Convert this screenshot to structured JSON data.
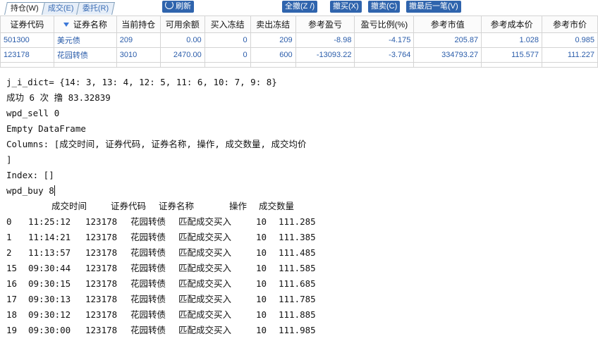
{
  "toolbar": {
    "tabs": [
      "持仓(W)",
      "成交(E)",
      "委托(R)"
    ],
    "refresh_label": "刷新",
    "cancel_all_label": "全撤(Z /)",
    "cancel_buy_label": "撤买(X)",
    "cancel_sell_label": "撤卖(C)",
    "cancel_last_label": "撤最后一笔(V)",
    "colors": {
      "button_bg": "#2f64ad",
      "cell_text": "#2a5caa"
    }
  },
  "positions": {
    "columns": [
      "证券代码",
      "证券名称",
      "当前持仓",
      "可用余额",
      "买入冻结",
      "卖出冻结",
      "参考盈亏",
      "盈亏比例(%)",
      "参考市值",
      "参考成本价",
      "参考市价"
    ],
    "rows": [
      [
        "501300",
        "美元债",
        "209",
        "0.00",
        "0",
        "209",
        "-8.98",
        "-4.175",
        "205.87",
        "1.028",
        "0.985"
      ],
      [
        "123178",
        "花园转债",
        "3010",
        "2470.00",
        "0",
        "600",
        "-13093.22",
        "-3.764",
        "334793.27",
        "115.577",
        "111.227"
      ]
    ]
  },
  "console": {
    "lines": [
      "j_i_dict= {14: 3, 13: 4, 12: 5, 11: 6, 10: 7, 9: 8}",
      "成功 6 次 撸 83.32839",
      "wpd_sell 0",
      "Empty DataFrame",
      "Columns: [成交时间, 证券代码, 证券名称, 操作, 成交数量, 成交均价",
      "]",
      "Index: []",
      "wpd_buy 8"
    ],
    "df_columns": [
      "成交时间",
      "证券代码",
      "证券名称",
      "操作",
      "成交数量"
    ],
    "df_rows": [
      [
        "0",
        "11:25:12",
        "123178",
        "花园转债",
        "匹配成交买入",
        "10",
        "111.285"
      ],
      [
        "1",
        "11:14:21",
        "123178",
        "花园转债",
        "匹配成交买入",
        "10",
        "111.385"
      ],
      [
        "2",
        "11:13:57",
        "123178",
        "花园转债",
        "匹配成交买入",
        "10",
        "111.485"
      ],
      [
        "15",
        "09:30:44",
        "123178",
        "花园转债",
        "匹配成交买入",
        "10",
        "111.585"
      ],
      [
        "16",
        "09:30:15",
        "123178",
        "花园转债",
        "匹配成交买入",
        "10",
        "111.685"
      ],
      [
        "17",
        "09:30:13",
        "123178",
        "花园转债",
        "匹配成交买入",
        "10",
        "111.785"
      ],
      [
        "18",
        "09:30:12",
        "123178",
        "花园转债",
        "匹配成交买入",
        "10",
        "111.885"
      ],
      [
        "19",
        "09:30:00",
        "123178",
        "花园转债",
        "匹配成交买入",
        "10",
        "111.985"
      ]
    ]
  }
}
